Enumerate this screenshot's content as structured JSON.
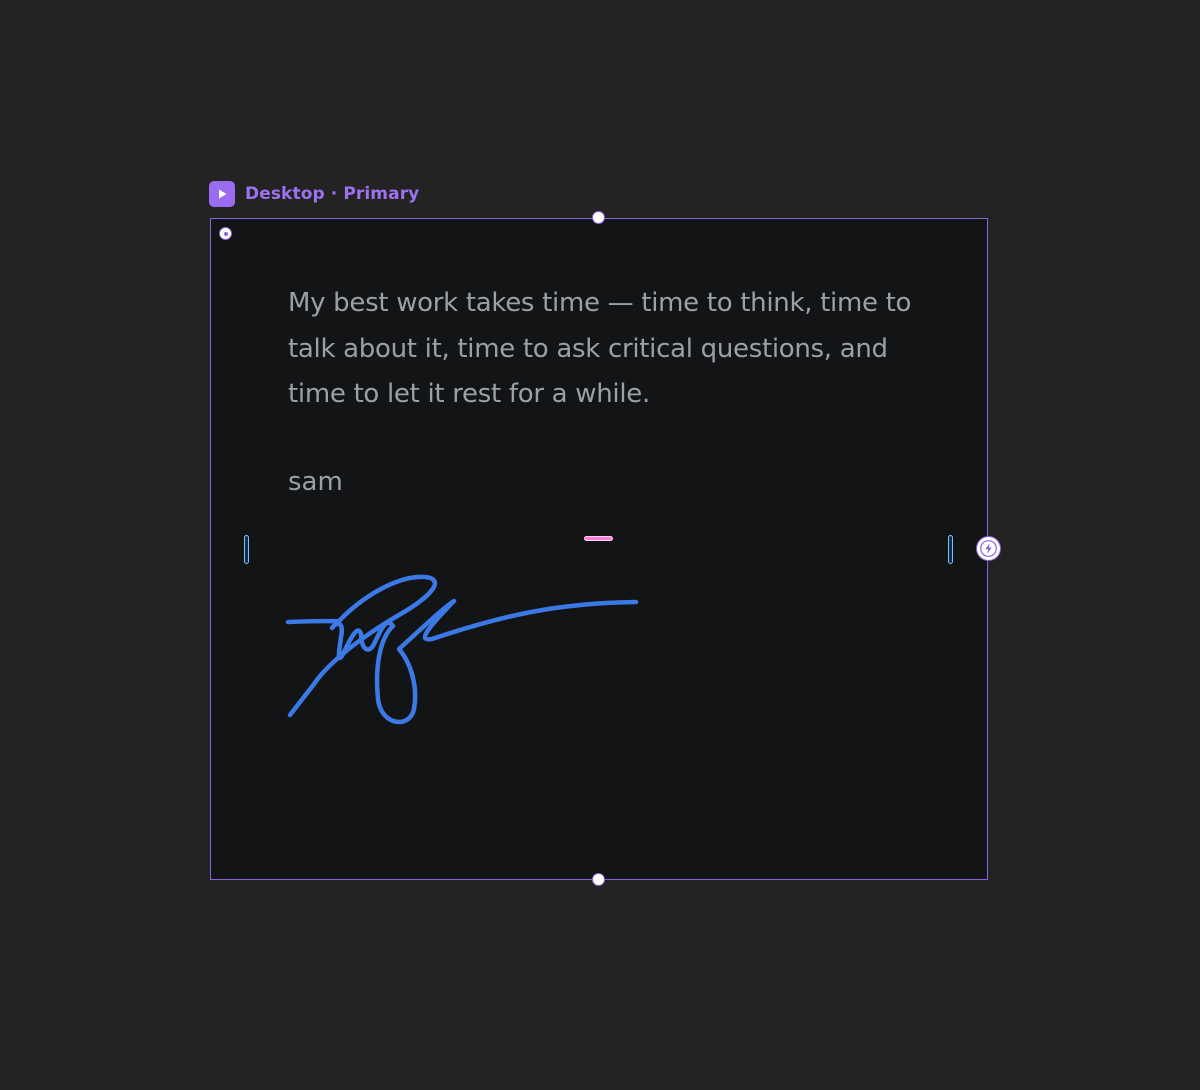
{
  "frame": {
    "label": "Desktop · Primary",
    "label_icon": "play-icon",
    "accent_color": "#9a6cf2",
    "background_color": "#131416"
  },
  "content": {
    "quote": "My best work takes time — time to think, time to talk about it, time to ask critical questions, and time to let it rest for a while.",
    "author": "sam",
    "text_color": "#9aa0a8"
  },
  "signature": {
    "stroke_color": "#3b7ae6"
  },
  "canvas": {
    "background_color": "#232323",
    "interaction_icon": "lightning-icon",
    "guide_colors": {
      "vertical": "#7fc0ff",
      "horizontal": "#ff7fd8"
    }
  }
}
